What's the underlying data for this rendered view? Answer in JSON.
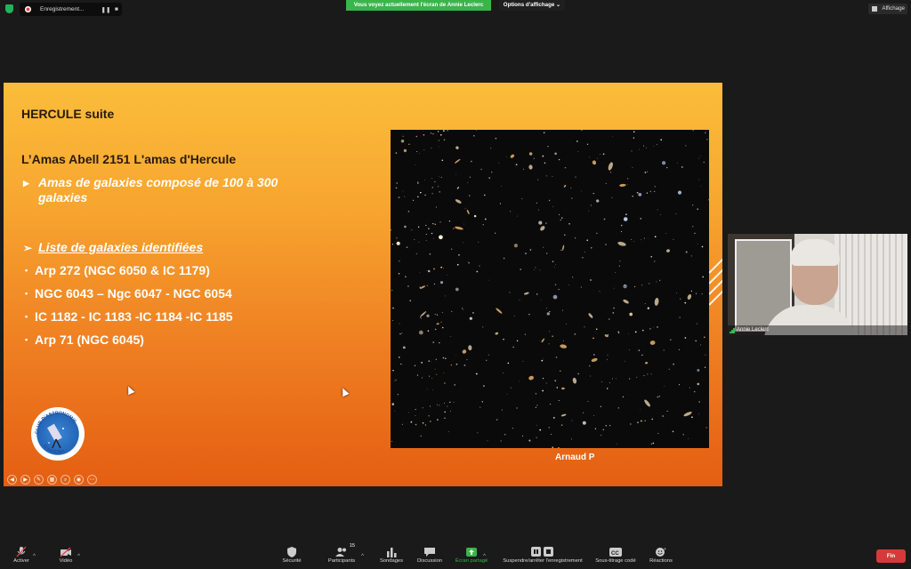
{
  "top_bar": {
    "recording_label": "Enregistrement...",
    "screen_share_banner": "Vous voyez actuellement l'écran de Annie Leclerc",
    "view_options_label": "Options d'affichage",
    "view_button_label": "Affichage"
  },
  "slide": {
    "title": "HERCULE suite",
    "heading": "L’Amas Abell 2151 L'amas d'Hercule",
    "description": "Amas de galaxies composé de 100 à 300 galaxies",
    "list_heading": "Liste de galaxies identifiées",
    "galaxies": [
      "Arp 272 (NGC 6050 & IC 1179)",
      "NGC 6043 – Ngc 6047 - NGC 6054",
      "IC 1182 - IC 1183 -IC 1184 -IC 1185",
      "Arp 71 (NGC 6045)"
    ],
    "image_caption": "Arnaud P",
    "logo_top_text": "CLUB D'ASTRONOMIE",
    "logo_bottom_text": "D'ANTONY"
  },
  "participant_video": {
    "name": "Annie Leclerc"
  },
  "toolbar": {
    "audio_label": "Activer",
    "video_label": "Vidéo",
    "security_label": "Sécurité",
    "participants_label": "Participants",
    "participants_count": "15",
    "polls_label": "Sondages",
    "chat_label": "Discussion",
    "share_label": "Écran partagé",
    "recording_label": "Suspendre/arrêter l'enregistrement",
    "captions_label": "Sous-titrage codé",
    "reactions_label": "Réactions",
    "end_label": "Fin"
  },
  "colors": {
    "share_banner": "#3ab54a",
    "end_button": "#d53a3a",
    "slide_top": "#fbbd3a",
    "slide_bottom": "#e45e12"
  }
}
